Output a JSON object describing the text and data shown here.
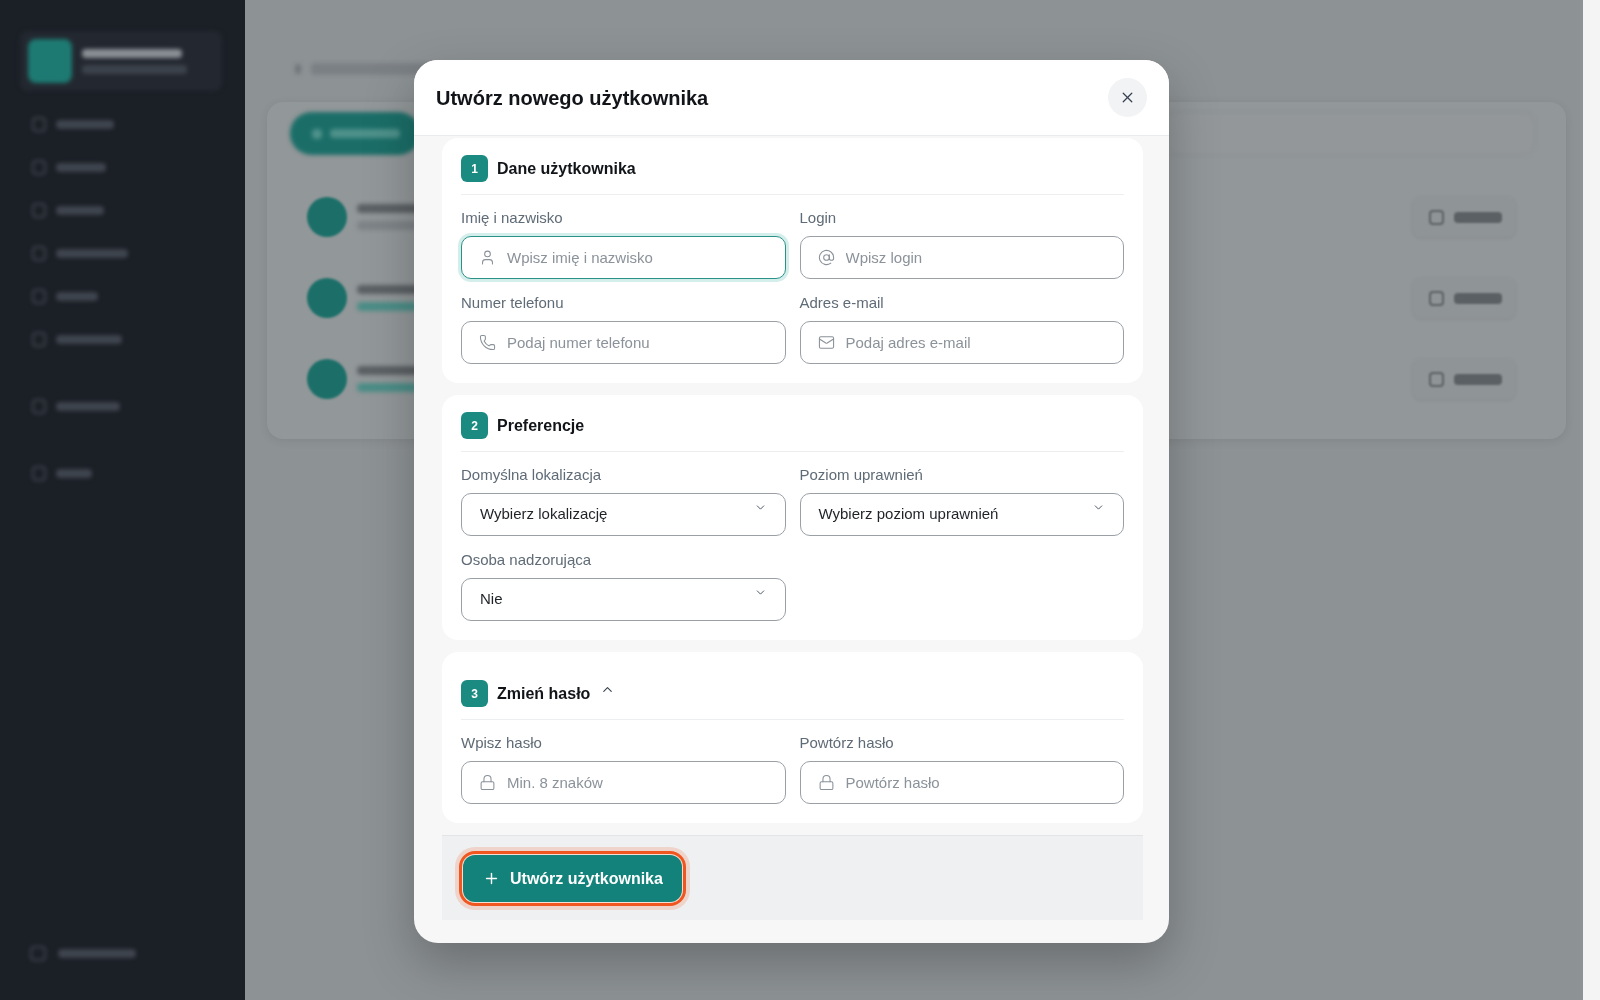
{
  "dialog": {
    "title": "Utwórz nowego użytkownika"
  },
  "sections": [
    {
      "number": "1",
      "title": "Dane użytkownika",
      "kind": "fixed",
      "fields": [
        {
          "kind": "name",
          "label": "Imię i nazwisko",
          "placeholder": "Wpisz imię i nazwisko",
          "focused": true
        },
        {
          "kind": "login",
          "label": "Login",
          "placeholder": "Wpisz login",
          "focused": false
        },
        {
          "kind": "phone",
          "label": "Numer telefonu",
          "placeholder": "Podaj numer telefonu",
          "focused": false
        },
        {
          "kind": "email",
          "label": "Adres e-mail",
          "placeholder": "Podaj adres e-mail",
          "focused": false
        }
      ]
    },
    {
      "number": "2",
      "title": "Preferencje",
      "kind": "fixed",
      "fields": [
        {
          "kind": "select",
          "label": "Domyślna lokalizacja",
          "value": "Wybierz lokalizację",
          "focused": false
        },
        {
          "kind": "select",
          "label": "Poziom uprawnień",
          "value": "Wybierz poziom uprawnień",
          "focused": false
        },
        {
          "kind": "select",
          "label": "Osoba nadzorująca",
          "value": "Nie",
          "focused": false
        }
      ]
    },
    {
      "number": "3",
      "title": "Zmień hasło",
      "kind": "collapsible",
      "expanded": true,
      "fields": [
        {
          "kind": "password",
          "label": "Wpisz hasło",
          "placeholder": "Min. 8 znaków",
          "focused": false
        },
        {
          "kind": "password",
          "label": "Powtórz hasło",
          "placeholder": "Powtórz hasło",
          "focused": false
        }
      ]
    }
  ],
  "submit_button": {
    "label": "Utwórz użytkownika",
    "focused": true
  }
}
